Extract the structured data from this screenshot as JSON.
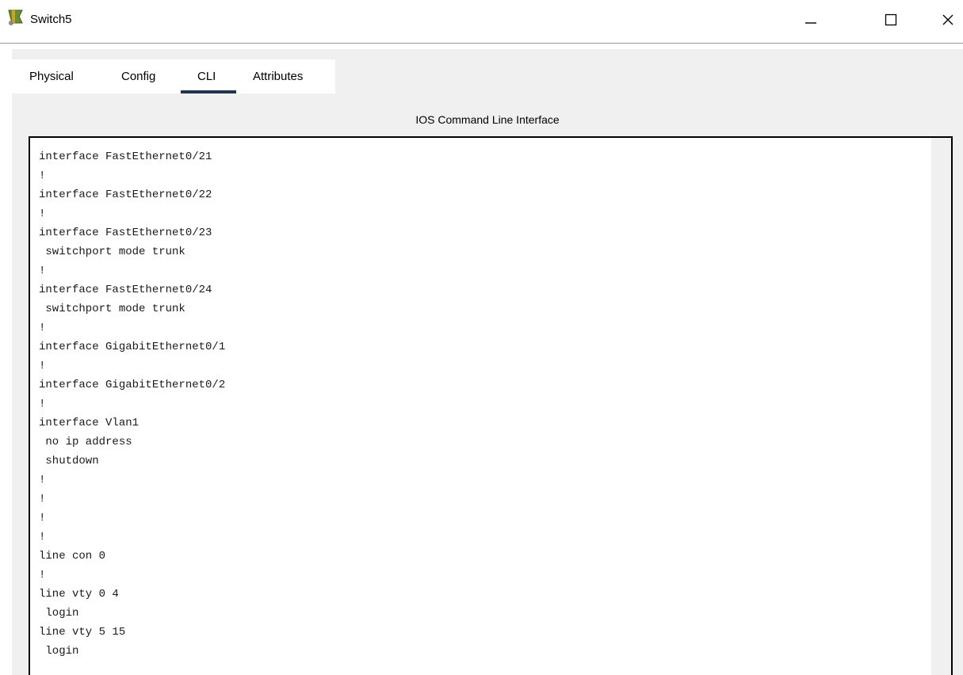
{
  "window": {
    "title": "Switch5",
    "controls": {
      "minimize_icon": "minimize-icon",
      "maximize_icon": "maximize-icon",
      "close_icon": "close-icon"
    }
  },
  "tabs": [
    {
      "label": "Physical",
      "active": false
    },
    {
      "label": "Config",
      "active": false
    },
    {
      "label": "CLI",
      "active": true
    },
    {
      "label": "Attributes",
      "active": false
    }
  ],
  "cli": {
    "title": "IOS Command Line Interface",
    "lines": [
      "interface FastEthernet0/21",
      "!",
      "interface FastEthernet0/22",
      "!",
      "interface FastEthernet0/23",
      " switchport mode trunk",
      "!",
      "interface FastEthernet0/24",
      " switchport mode trunk",
      "!",
      "interface GigabitEthernet0/1",
      "!",
      "interface GigabitEthernet0/2",
      "!",
      "interface Vlan1",
      " no ip address",
      " shutdown",
      "!",
      "!",
      "!",
      "!",
      "line con 0",
      "!",
      "line vty 0 4",
      " login",
      "line vty 5 15",
      " login"
    ]
  },
  "colors": {
    "tab_underline": "#1f3352",
    "panel_background": "#f0f0f0",
    "terminal_text": "#1a1a1a"
  }
}
